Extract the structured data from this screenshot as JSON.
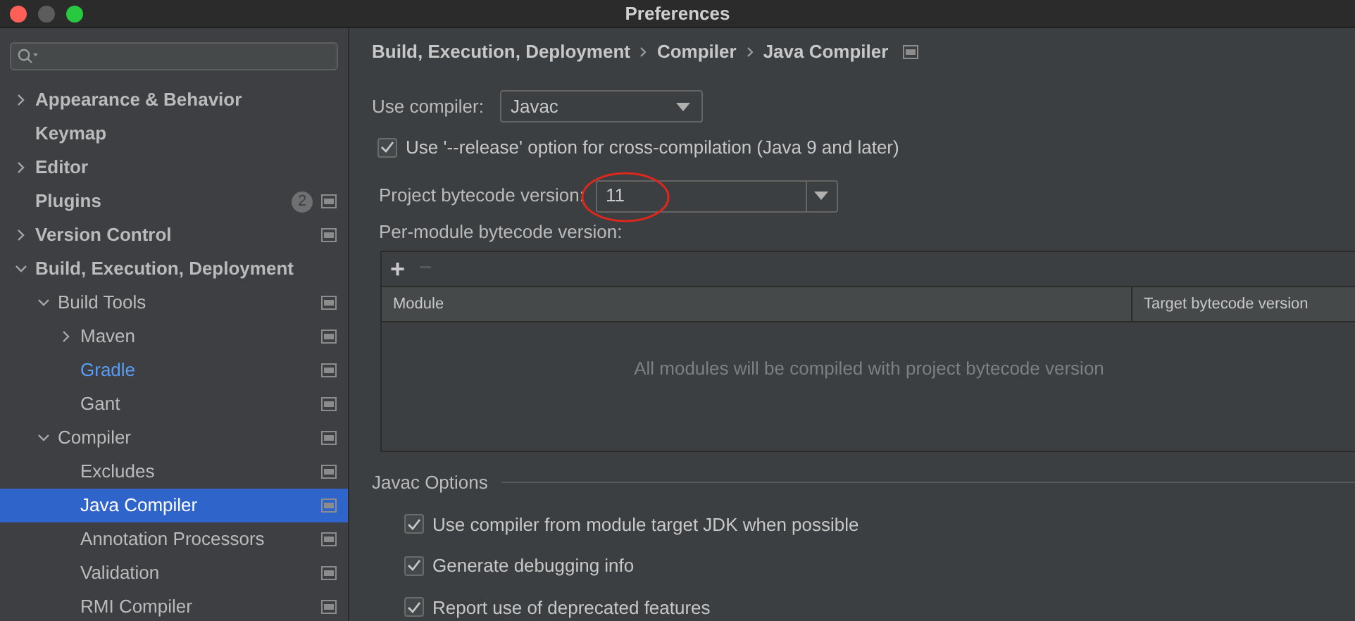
{
  "window": {
    "title": "Preferences"
  },
  "sidebar": {
    "tree": [
      {
        "label": "Appearance & Behavior",
        "bold": true,
        "expanded": false,
        "selected": false
      },
      {
        "label": "Keymap",
        "bold": true,
        "selected": false
      },
      {
        "label": "Editor",
        "bold": true,
        "expanded": false,
        "selected": false
      },
      {
        "label": "Plugins",
        "bold": true,
        "selected": false,
        "badge": "2",
        "project_scoped": true
      },
      {
        "label": "Version Control",
        "bold": true,
        "expanded": false,
        "selected": false,
        "project_scoped": true
      },
      {
        "label": "Build, Execution, Deployment",
        "bold": true,
        "expanded": true,
        "selected": false,
        "children": [
          {
            "label": "Build Tools",
            "expanded": true,
            "selected": false,
            "project_scoped": true,
            "children": [
              {
                "label": "Maven",
                "expanded": false,
                "selected": false,
                "project_scoped": true
              },
              {
                "label": "Gradle",
                "modified": true,
                "selected": false,
                "project_scoped": true
              },
              {
                "label": "Gant",
                "selected": false,
                "project_scoped": true
              }
            ]
          },
          {
            "label": "Compiler",
            "expanded": true,
            "selected": false,
            "project_scoped": true,
            "children": [
              {
                "label": "Excludes",
                "selected": false,
                "project_scoped": true
              },
              {
                "label": "Java Compiler",
                "selected": true,
                "project_scoped": true
              },
              {
                "label": "Annotation Processors",
                "selected": false,
                "project_scoped": true
              },
              {
                "label": "Validation",
                "selected": false,
                "project_scoped": true
              },
              {
                "label": "RMI Compiler",
                "selected": false,
                "project_scoped": true
              }
            ]
          }
        ]
      }
    ]
  },
  "breadcrumb": [
    "Build, Execution, Deployment",
    "Compiler",
    "Java Compiler"
  ],
  "use_compiler": {
    "label": "Use compiler:",
    "value": "Javac"
  },
  "release_option": {
    "label": "Use '--release' option for cross-compilation (Java 9 and later)",
    "checked": true
  },
  "project_bytecode": {
    "label": "Project bytecode version:",
    "value": "11",
    "circled": true
  },
  "per_module": {
    "label": "Per-module bytecode version:",
    "add": "+",
    "remove": "−",
    "columns": [
      "Module",
      "Target bytecode version"
    ],
    "empty_text": "All modules will be compiled with project bytecode version"
  },
  "javac_options": {
    "title": "Javac Options",
    "options": [
      {
        "label": "Use compiler from module target JDK when possible",
        "checked": true
      },
      {
        "label": "Generate debugging info",
        "checked": true
      },
      {
        "label": "Report use of deprecated features",
        "checked": true
      }
    ]
  }
}
